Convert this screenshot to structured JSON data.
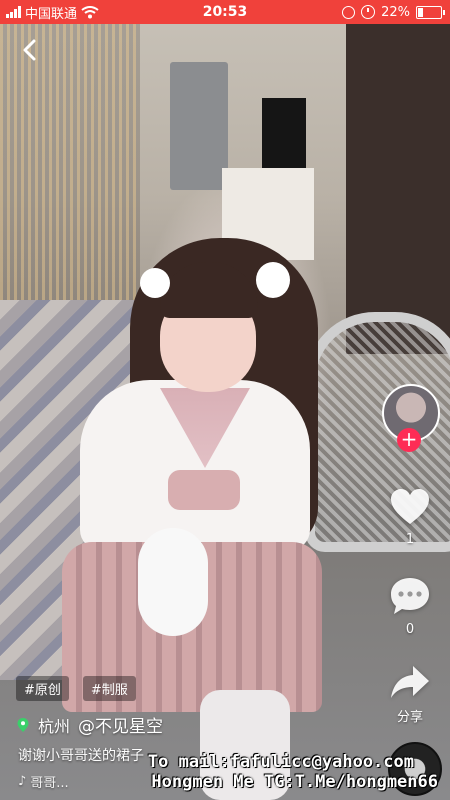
{
  "status_bar": {
    "carrier": "中国联通",
    "time": "20:53",
    "battery_percent_text": "22%",
    "battery_level": 0.22,
    "background_color": "#f0413b"
  },
  "video": {
    "description_icons": [
      "back-chevron-icon"
    ]
  },
  "actions": {
    "follow_label": "+",
    "like_count": "1",
    "comment_count": "0",
    "share_label": "分享"
  },
  "post": {
    "tags": [
      "#原创",
      "#制服"
    ],
    "location": "杭州",
    "username": "@不见星空",
    "caption": "谢谢小哥哥送的裙子",
    "music": "哥哥..."
  },
  "watermark": {
    "line1": "To mail:fafulicc@yahoo.com",
    "line2": "Hongmen Me TG:T.Me/hongmen66"
  },
  "colors": {
    "accent": "#fe2c55",
    "tag_green": "#3ad06a"
  }
}
